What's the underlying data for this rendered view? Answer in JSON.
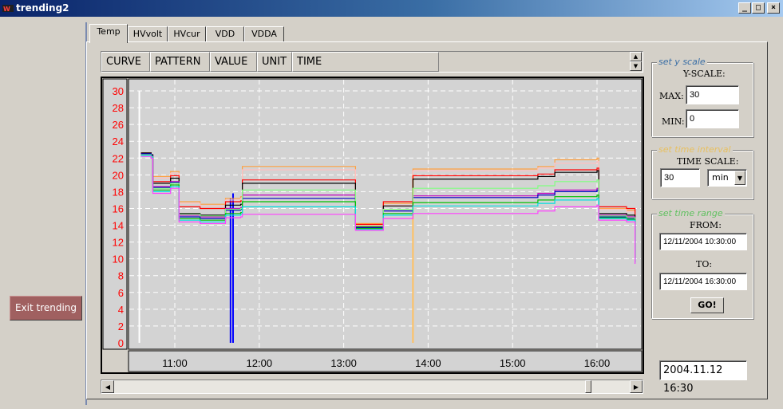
{
  "window": {
    "title": "trending2",
    "minimize": "_",
    "maximize": "□",
    "close": "×"
  },
  "exit_button": "Exit trending",
  "tabs": [
    {
      "label": "Temp",
      "active": true
    },
    {
      "label": "HVvolt",
      "active": false
    },
    {
      "label": "HVcur",
      "active": false
    },
    {
      "label": "VDD",
      "active": false
    },
    {
      "label": "VDDA",
      "active": false
    }
  ],
  "table_header": [
    "CURVE",
    "PATTERN",
    "VALUE",
    "UNIT",
    "TIME"
  ],
  "y_scale": {
    "legend": "set y scale",
    "title": "Y-SCALE:",
    "max_label": "MAX:",
    "max_value": "30",
    "min_label": "MIN:",
    "min_value": "0"
  },
  "time_interval": {
    "legend": "set time interval",
    "title": "TIME SCALE:",
    "value": "30",
    "unit": "min"
  },
  "time_range": {
    "legend": "set time range",
    "from_label": "FROM:",
    "from_value": "12/11/2004 10:30:00",
    "to_label": "TO:",
    "to_value": "12/11/2004 16:30:00",
    "go": "GO!"
  },
  "clock": "2004.11.12 16:30",
  "colors": {
    "y_axis_text": "#ff0000",
    "plot_bg": "#d3d3d3",
    "grid": "#ffffff",
    "legend_y": "#3a6ea5",
    "legend_time": "#e8c060",
    "legend_range": "#60c060",
    "exit_bg": "#a06060"
  },
  "chart_data": {
    "type": "line",
    "x_unit": "hours",
    "xlim": [
      10.5,
      16.5
    ],
    "ylim": [
      0,
      30
    ],
    "y_ticks": [
      0,
      2,
      4,
      6,
      8,
      10,
      12,
      14,
      16,
      18,
      20,
      22,
      24,
      26,
      28,
      30
    ],
    "x_ticks": [
      "11:00",
      "12:00",
      "13:00",
      "14:00",
      "15:00",
      "16:00"
    ],
    "x_tick_values": [
      11,
      12,
      13,
      14,
      15,
      16
    ],
    "grid": true,
    "series": [
      {
        "color": "#ffa040",
        "values": [
          [
            10.6,
            22.6
          ],
          [
            10.72,
            22.4
          ],
          [
            10.74,
            19.8
          ],
          [
            10.95,
            20.4
          ],
          [
            11.05,
            16.8
          ],
          [
            11.3,
            16.5
          ],
          [
            11.6,
            17.2
          ],
          [
            11.78,
            17.4
          ],
          [
            11.8,
            21.0
          ],
          [
            13.12,
            21.0
          ],
          [
            13.14,
            14.2
          ],
          [
            13.45,
            14.2
          ],
          [
            13.47,
            16.6
          ],
          [
            13.8,
            16.6
          ],
          [
            13.82,
            20.7
          ],
          [
            14.6,
            20.7
          ],
          [
            15.3,
            21.0
          ],
          [
            15.5,
            21.8
          ],
          [
            16.0,
            22.0
          ],
          [
            16.02,
            16.0
          ],
          [
            16.35,
            15.8
          ],
          [
            16.45,
            11.0
          ]
        ]
      },
      {
        "color": "#ffc0c0",
        "values": [
          [
            10.6,
            22.4
          ],
          [
            10.72,
            22.2
          ],
          [
            10.74,
            19.6
          ],
          [
            10.95,
            20.2
          ],
          [
            11.05,
            16.6
          ],
          [
            11.3,
            16.3
          ],
          [
            11.6,
            17.0
          ],
          [
            11.78,
            17.2
          ],
          [
            11.8,
            20.6
          ],
          [
            13.12,
            20.6
          ],
          [
            13.14,
            14.0
          ],
          [
            13.45,
            14.0
          ],
          [
            13.47,
            16.4
          ],
          [
            13.8,
            16.4
          ],
          [
            13.82,
            20.5
          ],
          [
            14.6,
            20.5
          ],
          [
            15.3,
            20.8
          ],
          [
            15.5,
            21.4
          ],
          [
            16.0,
            21.6
          ],
          [
            16.02,
            15.9
          ],
          [
            16.35,
            15.6
          ],
          [
            16.45,
            10.8
          ]
        ]
      },
      {
        "color": "#ff0000",
        "values": [
          [
            10.6,
            22.6
          ],
          [
            10.72,
            22.4
          ],
          [
            10.74,
            19.2
          ],
          [
            10.95,
            19.9
          ],
          [
            11.05,
            16.2
          ],
          [
            11.3,
            16.0
          ],
          [
            11.6,
            16.8
          ],
          [
            11.78,
            16.9
          ],
          [
            11.8,
            19.4
          ],
          [
            13.12,
            19.4
          ],
          [
            13.14,
            14.1
          ],
          [
            13.45,
            14.1
          ],
          [
            13.47,
            16.8
          ],
          [
            13.8,
            16.8
          ],
          [
            13.82,
            19.9
          ],
          [
            14.6,
            19.9
          ],
          [
            15.3,
            20.1
          ],
          [
            15.5,
            20.6
          ],
          [
            16.0,
            20.8
          ],
          [
            16.02,
            16.2
          ],
          [
            16.35,
            16.0
          ],
          [
            16.45,
            12.8
          ]
        ]
      },
      {
        "color": "#000000",
        "values": [
          [
            10.6,
            22.6
          ],
          [
            10.72,
            22.4
          ],
          [
            10.74,
            19.0
          ],
          [
            10.95,
            19.6
          ],
          [
            11.05,
            15.4
          ],
          [
            11.3,
            15.2
          ],
          [
            11.6,
            16.4
          ],
          [
            11.78,
            16.5
          ],
          [
            11.8,
            19.0
          ],
          [
            13.12,
            19.0
          ],
          [
            13.14,
            13.8
          ],
          [
            13.45,
            13.8
          ],
          [
            13.47,
            16.3
          ],
          [
            13.8,
            16.3
          ],
          [
            13.82,
            19.5
          ],
          [
            14.6,
            19.5
          ],
          [
            15.3,
            19.8
          ],
          [
            15.5,
            20.3
          ],
          [
            16.0,
            20.5
          ],
          [
            16.02,
            15.4
          ],
          [
            16.35,
            15.2
          ],
          [
            16.45,
            10.2
          ]
        ]
      },
      {
        "color": "#c000c0",
        "values": [
          [
            10.6,
            22.5
          ],
          [
            10.72,
            22.3
          ],
          [
            10.74,
            18.6
          ],
          [
            10.95,
            19.2
          ],
          [
            11.05,
            15.2
          ],
          [
            11.3,
            15.0
          ],
          [
            11.6,
            16.0
          ],
          [
            11.78,
            16.1
          ],
          [
            11.8,
            17.6
          ],
          [
            13.12,
            17.6
          ],
          [
            13.14,
            13.9
          ],
          [
            13.45,
            13.9
          ],
          [
            13.47,
            15.9
          ],
          [
            13.8,
            15.9
          ],
          [
            13.82,
            17.5
          ],
          [
            14.6,
            17.5
          ],
          [
            15.3,
            17.8
          ],
          [
            15.5,
            18.2
          ],
          [
            16.0,
            18.4
          ],
          [
            16.02,
            15.2
          ],
          [
            16.35,
            15.0
          ],
          [
            16.45,
            10.4
          ]
        ]
      },
      {
        "color": "#0000c0",
        "values": [
          [
            10.6,
            22.5
          ],
          [
            10.72,
            22.3
          ],
          [
            10.74,
            18.5
          ],
          [
            10.95,
            19.1
          ],
          [
            11.05,
            15.0
          ],
          [
            11.3,
            14.8
          ],
          [
            11.6,
            15.8
          ],
          [
            11.78,
            15.9
          ],
          [
            11.8,
            17.2
          ],
          [
            13.12,
            17.2
          ],
          [
            13.14,
            13.7
          ],
          [
            13.45,
            13.7
          ],
          [
            13.47,
            15.7
          ],
          [
            13.8,
            15.7
          ],
          [
            13.82,
            17.3
          ],
          [
            14.6,
            17.3
          ],
          [
            15.3,
            17.6
          ],
          [
            15.5,
            18.0
          ],
          [
            16.0,
            18.2
          ],
          [
            16.02,
            15.0
          ],
          [
            16.35,
            14.8
          ],
          [
            16.45,
            10.0
          ]
        ]
      },
      {
        "color": "#80ff80",
        "values": [
          [
            10.6,
            22.4
          ],
          [
            10.72,
            22.2
          ],
          [
            10.74,
            18.4
          ],
          [
            10.95,
            19.0
          ],
          [
            11.05,
            15.3
          ],
          [
            11.3,
            15.1
          ],
          [
            11.6,
            15.9
          ],
          [
            11.78,
            16.0
          ],
          [
            11.8,
            18.2
          ],
          [
            13.12,
            18.2
          ],
          [
            13.14,
            13.9
          ],
          [
            13.45,
            13.9
          ],
          [
            13.47,
            15.9
          ],
          [
            13.8,
            15.9
          ],
          [
            13.82,
            18.4
          ],
          [
            14.6,
            18.4
          ],
          [
            15.3,
            18.7
          ],
          [
            15.5,
            19.2
          ],
          [
            16.0,
            19.4
          ],
          [
            16.02,
            15.1
          ],
          [
            16.35,
            14.9
          ],
          [
            16.45,
            10.1
          ]
        ]
      },
      {
        "color": "#00c000",
        "values": [
          [
            10.6,
            22.3
          ],
          [
            10.72,
            22.1
          ],
          [
            10.74,
            18.2
          ],
          [
            10.95,
            18.8
          ],
          [
            11.05,
            14.8
          ],
          [
            11.3,
            14.6
          ],
          [
            11.6,
            15.4
          ],
          [
            11.78,
            15.5
          ],
          [
            11.8,
            16.8
          ],
          [
            13.12,
            16.8
          ],
          [
            13.14,
            13.6
          ],
          [
            13.45,
            13.6
          ],
          [
            13.47,
            15.4
          ],
          [
            13.8,
            15.4
          ],
          [
            13.82,
            16.7
          ],
          [
            14.6,
            16.7
          ],
          [
            15.3,
            17.0
          ],
          [
            15.5,
            17.4
          ],
          [
            16.0,
            17.6
          ],
          [
            16.02,
            14.9
          ],
          [
            16.35,
            14.7
          ],
          [
            16.45,
            9.6
          ]
        ]
      },
      {
        "color": "#00e0e0",
        "values": [
          [
            10.6,
            22.3
          ],
          [
            10.72,
            22.1
          ],
          [
            10.74,
            18.0
          ],
          [
            10.95,
            18.6
          ],
          [
            11.05,
            14.6
          ],
          [
            11.3,
            14.4
          ],
          [
            11.6,
            15.2
          ],
          [
            11.78,
            15.3
          ],
          [
            11.8,
            16.2
          ],
          [
            13.12,
            16.2
          ],
          [
            13.14,
            13.5
          ],
          [
            13.45,
            13.5
          ],
          [
            13.47,
            15.2
          ],
          [
            13.8,
            15.2
          ],
          [
            13.82,
            16.3
          ],
          [
            14.6,
            16.3
          ],
          [
            15.3,
            16.6
          ],
          [
            15.5,
            17.0
          ],
          [
            16.0,
            17.2
          ],
          [
            16.02,
            14.8
          ],
          [
            16.35,
            14.6
          ],
          [
            16.45,
            9.5
          ]
        ]
      },
      {
        "color": "#ff40ff",
        "values": [
          [
            10.6,
            22.2
          ],
          [
            10.72,
            22.0
          ],
          [
            10.74,
            17.8
          ],
          [
            10.95,
            18.4
          ],
          [
            11.05,
            14.4
          ],
          [
            11.3,
            14.2
          ],
          [
            11.6,
            14.9
          ],
          [
            11.78,
            15.0
          ],
          [
            11.8,
            15.3
          ],
          [
            13.12,
            15.3
          ],
          [
            13.14,
            13.4
          ],
          [
            13.45,
            13.4
          ],
          [
            13.47,
            14.8
          ],
          [
            13.8,
            14.8
          ],
          [
            13.82,
            15.4
          ],
          [
            14.6,
            15.4
          ],
          [
            15.3,
            15.7
          ],
          [
            15.5,
            16.2
          ],
          [
            16.0,
            16.4
          ],
          [
            16.02,
            14.6
          ],
          [
            16.35,
            14.4
          ],
          [
            16.45,
            9.4
          ]
        ]
      }
    ],
    "spikes": [
      {
        "color": "#ffffff",
        "x": 10.58,
        "top": 30
      },
      {
        "color": "#0000ff",
        "x": 11.66,
        "top": 17.2
      },
      {
        "color": "#0000ff",
        "x": 11.69,
        "top": 17.8
      },
      {
        "color": "#ffc060",
        "x": 13.82,
        "top": 20.0
      }
    ]
  }
}
